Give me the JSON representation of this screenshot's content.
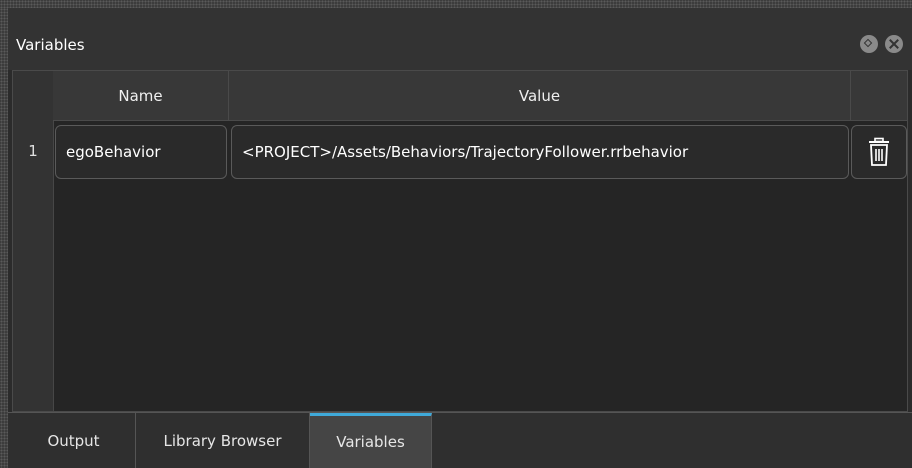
{
  "panel": {
    "title": "Variables",
    "icons": [
      "dock-icon",
      "close-icon"
    ]
  },
  "table": {
    "columns": [
      "Name",
      "Value",
      ""
    ],
    "rows": [
      {
        "index": "1",
        "name": "egoBehavior",
        "value": "<PROJECT>/Assets/Behaviors/TrajectoryFollower.rrbehavior",
        "action_icon": "trash-icon"
      }
    ]
  },
  "tabs": {
    "items": [
      "Output",
      "Library Browser",
      "Variables"
    ],
    "active": "Variables",
    "active_accent_color": "#3fa9d9"
  }
}
